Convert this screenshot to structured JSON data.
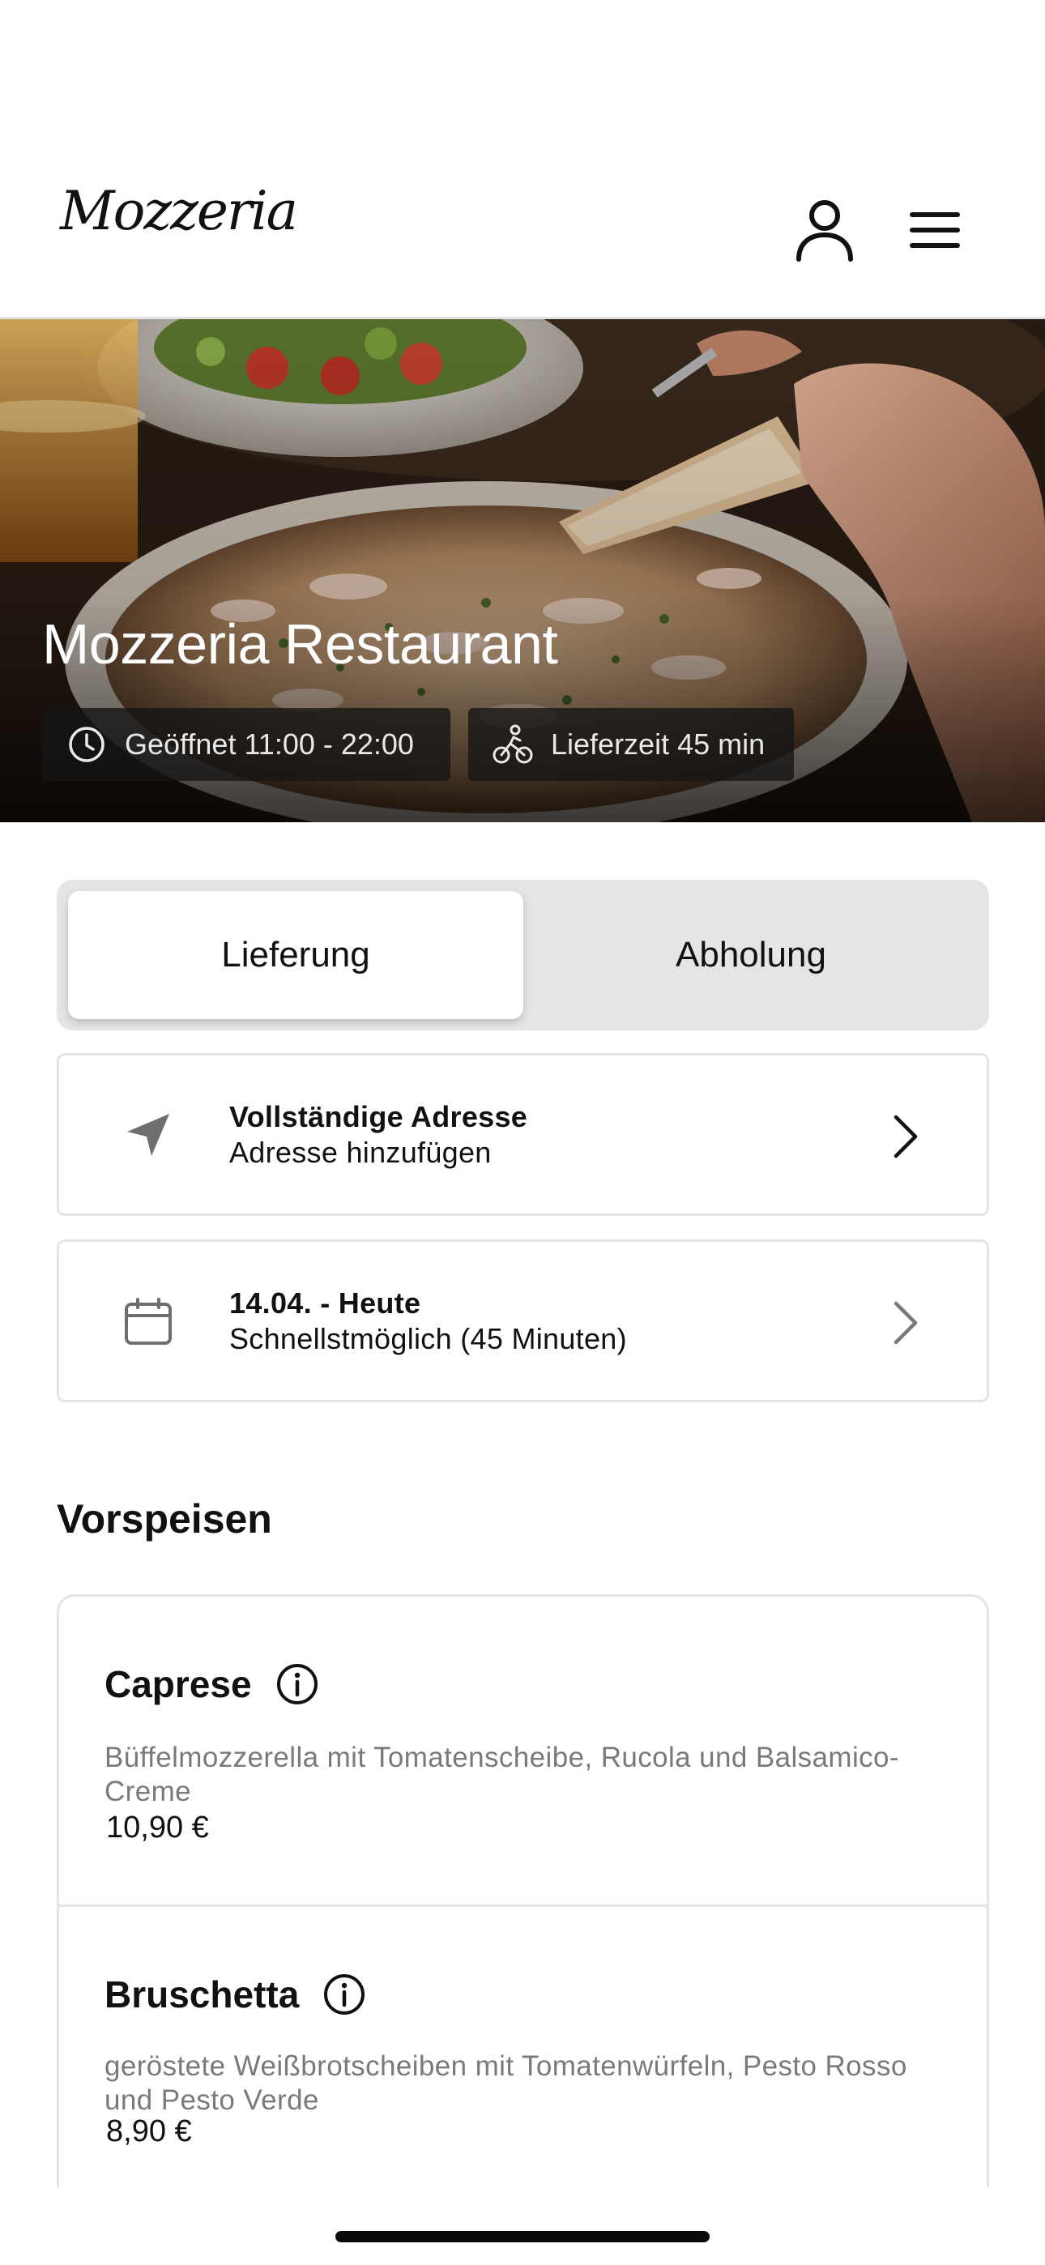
{
  "header": {
    "logo": "Mozzeria",
    "profile_icon": "user-icon",
    "menu_icon": "hamburger-menu-icon"
  },
  "hero": {
    "title": "Mozzeria Restaurant",
    "opening_hours": "Geöffnet 11:00 - 22:00",
    "delivery_time": "Lieferzeit 45 min",
    "opening_icon": "clock-icon",
    "delivery_icon": "bicycle-icon"
  },
  "order_mode": {
    "options": [
      "Lieferung",
      "Abholung"
    ],
    "selected": "Lieferung"
  },
  "address": {
    "title": "Vollständige Adresse",
    "subtitle": "Adresse hinzufügen",
    "icon": "location-arrow-icon"
  },
  "schedule": {
    "title": "14.04. - Heute",
    "subtitle": "Schnellstmöglich (45 Minuten)",
    "icon": "calendar-icon"
  },
  "section": {
    "title": "Vorspeisen"
  },
  "menu_items": [
    {
      "name": "Caprese",
      "description": "Büffelmozzerella mit Tomatenscheibe, Rucola und Balsamico-Creme",
      "price": "10,90 €"
    },
    {
      "name": "Bruschetta",
      "description": "geröstete Weißbrotscheiben mit Tomatenwürfeln, Pesto Rosso und Pesto Verde",
      "price": "8,90 €"
    }
  ],
  "colors": {
    "background": "#ffffff",
    "text": "#111111",
    "muted_text": "#7a7a7a",
    "border": "#e4e4e4",
    "segment_bg": "#e5e5e5",
    "chip_bg": "#141414"
  }
}
